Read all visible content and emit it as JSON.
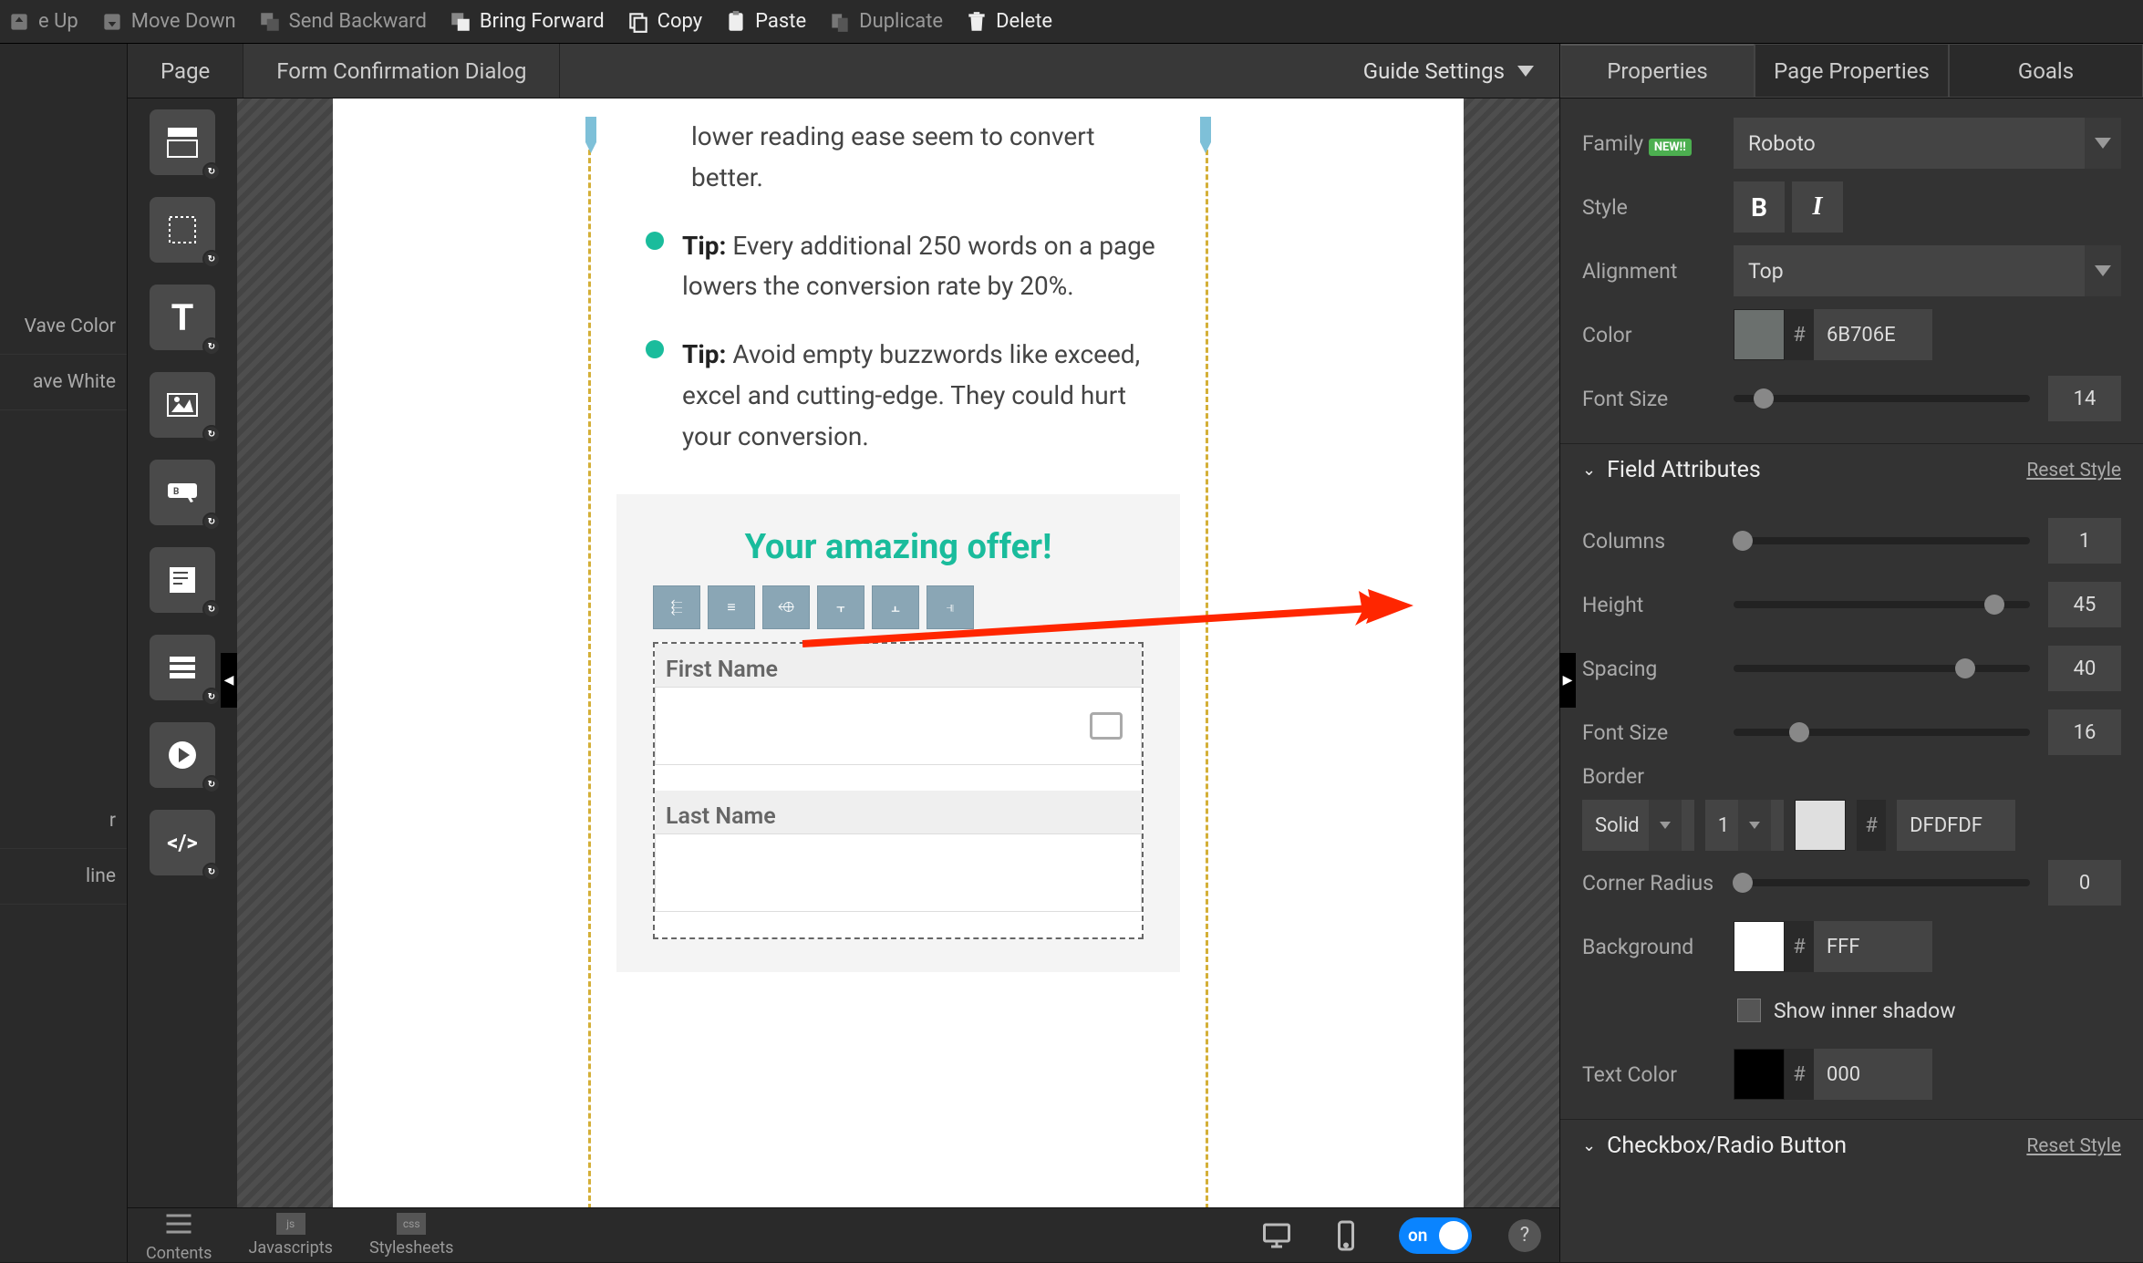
{
  "toolbar": {
    "move_up": "e Up",
    "move_down": "Move Down",
    "send_backward": "Send Backward",
    "bring_forward": "Bring Forward",
    "copy": "Copy",
    "paste": "Paste",
    "duplicate": "Duplicate",
    "delete": "Delete"
  },
  "left_items": {
    "wave_color": "Vave Color",
    "wave_white": "ave White",
    "r": "r",
    "line": "line"
  },
  "tabs": {
    "page": "Page",
    "form_dialog": "Form Confirmation Dialog",
    "guide": "Guide Settings"
  },
  "canvas": {
    "tip1_cut": "lower reading ease seem to convert better.",
    "tip2": "Every additional 250 words on a page lowers the conversion rate by 20%.",
    "tip3": "Avoid empty buzzwords like exceed, excel and cutting-edge. They could hurt your conversion.",
    "tip_label": "Tip:",
    "form_title": "Your amazing offer!",
    "first_name": "First Name",
    "last_name": "Last Name"
  },
  "bottom": {
    "contents": "Contents",
    "javascripts": "Javascripts",
    "stylesheets": "Stylesheets",
    "toggle": "on",
    "help": "?"
  },
  "rp_tabs": {
    "properties": "Properties",
    "page_properties": "Page Properties",
    "goals": "Goals"
  },
  "font": {
    "family_label": "Family",
    "new_badge": "NEW!!",
    "family_value": "Roboto",
    "style_label": "Style",
    "alignment_label": "Alignment",
    "alignment_value": "Top",
    "color_label": "Color",
    "color_hex": "6B706E",
    "fontsize_label": "Font Size",
    "fontsize_value": "14"
  },
  "field_attrs": {
    "header": "Field Attributes",
    "reset": "Reset Style",
    "columns_label": "Columns",
    "columns_value": "1",
    "height_label": "Height",
    "height_value": "45",
    "spacing_label": "Spacing",
    "spacing_value": "40",
    "fontsize_label": "Font Size",
    "fontsize_value": "16",
    "border_label": "Border",
    "border_style": "Solid",
    "border_width": "1",
    "border_hex": "DFDFDF",
    "corner_label": "Corner Radius",
    "corner_value": "0",
    "bg_label": "Background",
    "bg_hex": "FFF",
    "shadow_label": "Show inner shadow",
    "text_color_label": "Text Color",
    "text_color_hex": "000"
  },
  "checkbox_section": {
    "header": "Checkbox/Radio Button",
    "reset": "Reset Style"
  }
}
